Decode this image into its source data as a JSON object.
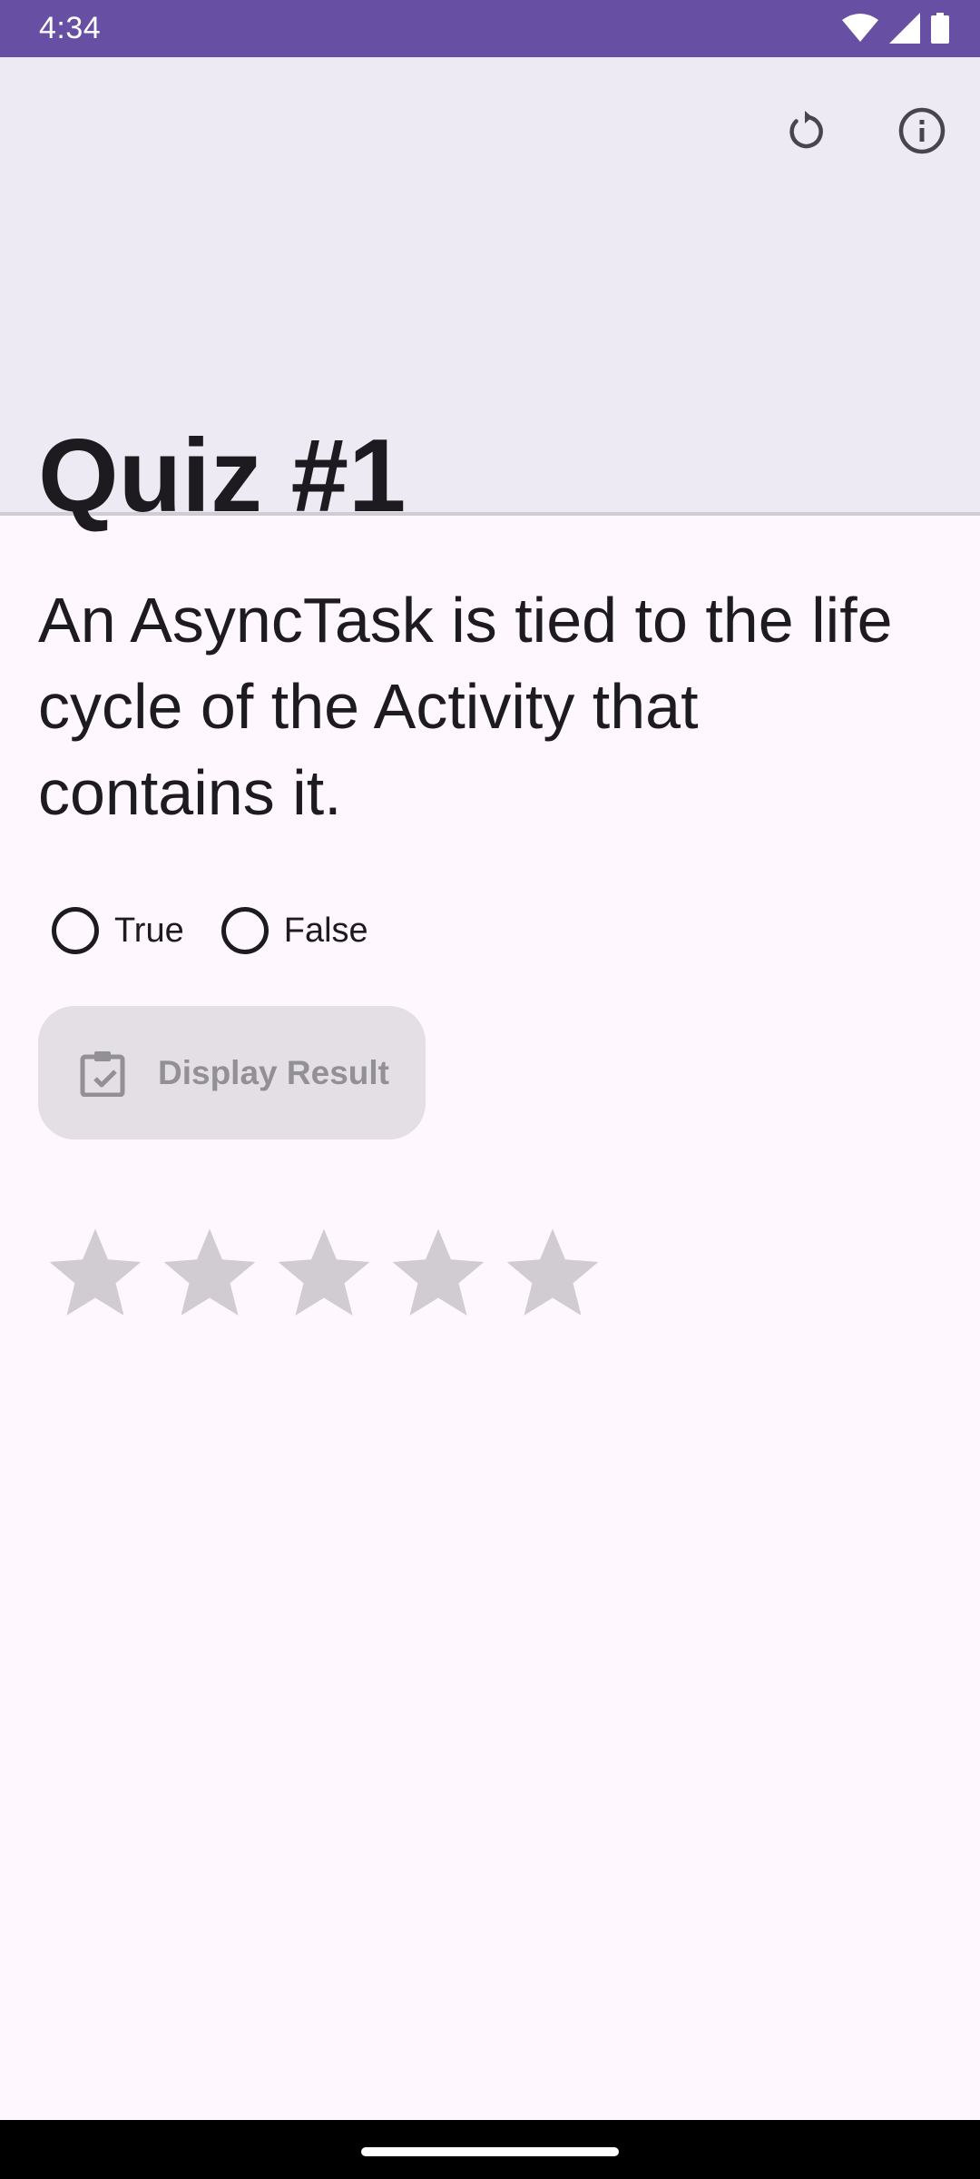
{
  "status_bar": {
    "time": "4:34",
    "icons": [
      "wifi-icon",
      "cell-signal-icon",
      "battery-icon"
    ]
  },
  "app_bar": {
    "title": "Quiz #1",
    "actions": [
      "refresh-icon",
      "info-icon"
    ]
  },
  "question": {
    "text": "An AsyncTask is tied to the life cycle of the Activity that contains it."
  },
  "answers": {
    "options": [
      {
        "label": "True",
        "selected": false
      },
      {
        "label": "False",
        "selected": false
      }
    ]
  },
  "result_button": {
    "label": "Display Result",
    "icon": "clipboard-check-icon",
    "enabled": false
  },
  "rating": {
    "max_stars": 5,
    "value": 0
  },
  "colors": {
    "status_bar": "#6750a4",
    "app_bar": "#eeeaf3",
    "background": "#fef7fd",
    "disabled_button": "#e3dfe4",
    "star_empty": "#d0ccd1"
  }
}
